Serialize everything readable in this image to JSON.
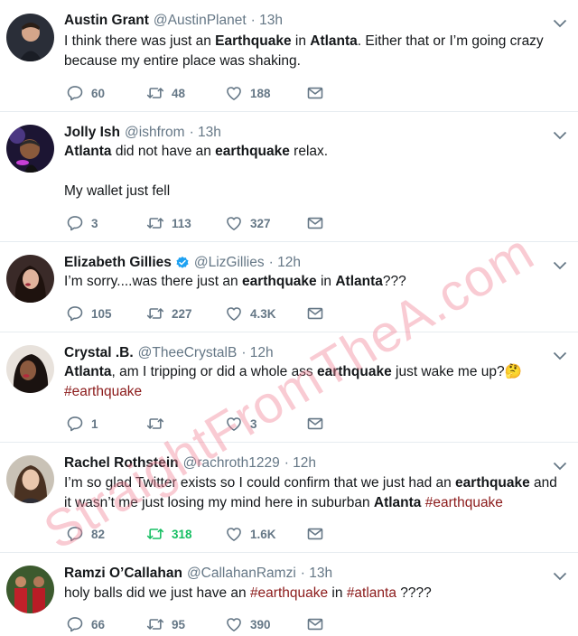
{
  "tweets": [
    {
      "name": "Austin Grant",
      "handle": "@AustinPlanet",
      "time": "· 13h",
      "verified": false,
      "paragraphs": [
        [
          {
            "t": "I think there was just an "
          },
          {
            "t": "Earthquake",
            "b": true
          },
          {
            "t": " in "
          },
          {
            "t": "Atlanta",
            "b": true
          },
          {
            "t": ". Either that or I’m going crazy because my entire place was shaking."
          }
        ]
      ],
      "replies": "60",
      "retweets": "48",
      "likes": "188",
      "retweeted": false
    },
    {
      "name": "Jolly Ish",
      "handle": "@ishfrom",
      "time": "· 13h",
      "verified": false,
      "paragraphs": [
        [
          {
            "t": "Atlanta",
            "b": true
          },
          {
            "t": " did not have an "
          },
          {
            "t": "earthquake",
            "b": true
          },
          {
            "t": " relax."
          }
        ],
        [
          {
            "t": "My wallet just fell"
          }
        ]
      ],
      "replies": "3",
      "retweets": "113",
      "likes": "327",
      "retweeted": false
    },
    {
      "name": "Elizabeth Gillies",
      "handle": "@LizGillies",
      "time": "· 12h",
      "verified": true,
      "paragraphs": [
        [
          {
            "t": "I’m sorry....was there just an "
          },
          {
            "t": "earthquake",
            "b": true
          },
          {
            "t": " in "
          },
          {
            "t": "Atlanta",
            "b": true
          },
          {
            "t": "???"
          }
        ]
      ],
      "replies": "105",
      "retweets": "227",
      "likes": "4.3K",
      "retweeted": false
    },
    {
      "name": "Crystal .B.",
      "handle": "@TheeCrystalB",
      "time": "· 12h",
      "verified": false,
      "paragraphs": [
        [
          {
            "t": "Atlanta",
            "b": true
          },
          {
            "t": ", am I tripping or did a whole ass "
          },
          {
            "t": "earthquake",
            "b": true
          },
          {
            "t": " just wake me up?"
          },
          {
            "t": "🤔",
            "emoji": true
          },
          {
            "t": " "
          },
          {
            "t": "#earthquake",
            "h": true
          }
        ]
      ],
      "replies": "1",
      "retweets": "",
      "likes": "3",
      "retweeted": false
    },
    {
      "name": "Rachel Rothstein",
      "handle": "@rachroth1229",
      "time": "· 12h",
      "verified": false,
      "paragraphs": [
        [
          {
            "t": "I’m so glad Twitter exists so I could confirm that we just had an "
          },
          {
            "t": "earthquake",
            "b": true
          },
          {
            "t": " and it wasn’t me just losing my mind here in suburban "
          },
          {
            "t": "Atlanta",
            "b": true
          },
          {
            "t": " "
          },
          {
            "t": "#earthquake",
            "h": true
          }
        ]
      ],
      "replies": "82",
      "retweets": "318",
      "likes": "1.6K",
      "retweeted": true
    },
    {
      "name": "Ramzi O’Callahan",
      "handle": "@CallahanRamzi",
      "time": "· 13h",
      "verified": false,
      "paragraphs": [
        [
          {
            "t": "holy balls did we just have an "
          },
          {
            "t": "#earthquake",
            "h": true
          },
          {
            "t": " in "
          },
          {
            "t": "#atlanta",
            "h": true
          },
          {
            "t": " ????"
          }
        ]
      ],
      "replies": "66",
      "retweets": "95",
      "likes": "390",
      "retweeted": false
    }
  ],
  "watermark": "StraightFromTheA.com",
  "colors": {
    "text": "#14171a",
    "muted": "#657786",
    "icon": "#657786",
    "retweet_active": "#17bf63",
    "hashtag": "#8b1a1a",
    "verified": "#1da1f2",
    "divider": "#e6ecf0",
    "watermark": "#f08296"
  }
}
